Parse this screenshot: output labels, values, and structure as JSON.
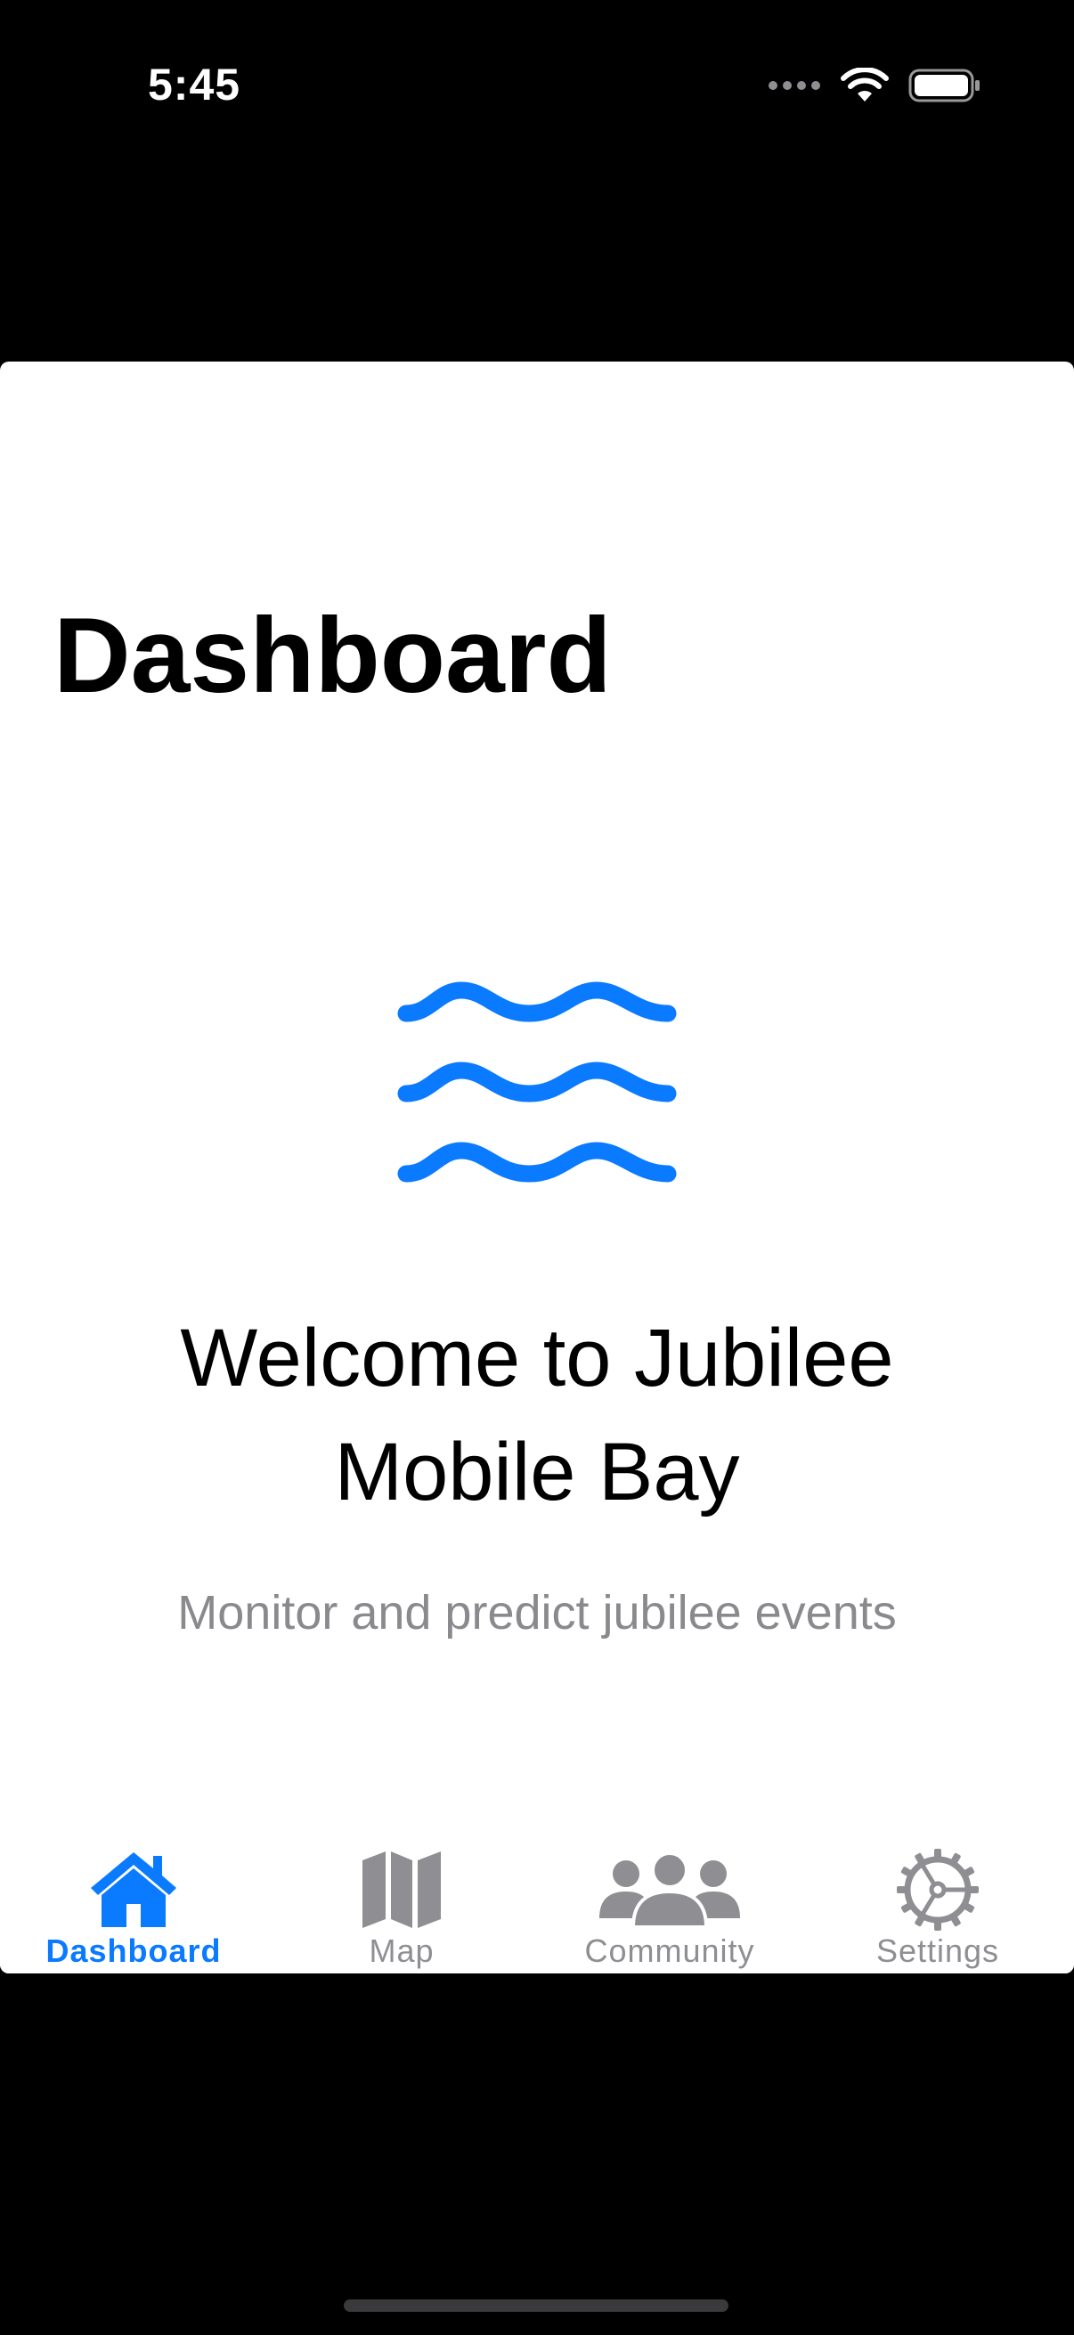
{
  "status_bar": {
    "time": "5:45",
    "icons": [
      "more-dots-icon",
      "wifi-icon",
      "battery-icon"
    ]
  },
  "page": {
    "title": "Dashboard"
  },
  "hero": {
    "icon": "water-waves-icon",
    "welcome_text": "Welcome to Jubilee Mobile Bay",
    "subtitle": "Monitor and predict jubilee events"
  },
  "tab_bar": {
    "active_color": "#0A7AFF",
    "inactive_color": "#8E8E93",
    "tabs": [
      {
        "label": "Dashboard",
        "icon": "house-icon",
        "active": true
      },
      {
        "label": "Map",
        "icon": "map-icon",
        "active": false
      },
      {
        "label": "Community",
        "icon": "people-icon",
        "active": false
      },
      {
        "label": "Settings",
        "icon": "gear-icon",
        "active": false
      }
    ]
  },
  "colors": {
    "accent": "#0A7AFF",
    "background": "#FFFFFF",
    "chrome": "#000000",
    "secondary_text": "#8A8A8E"
  }
}
